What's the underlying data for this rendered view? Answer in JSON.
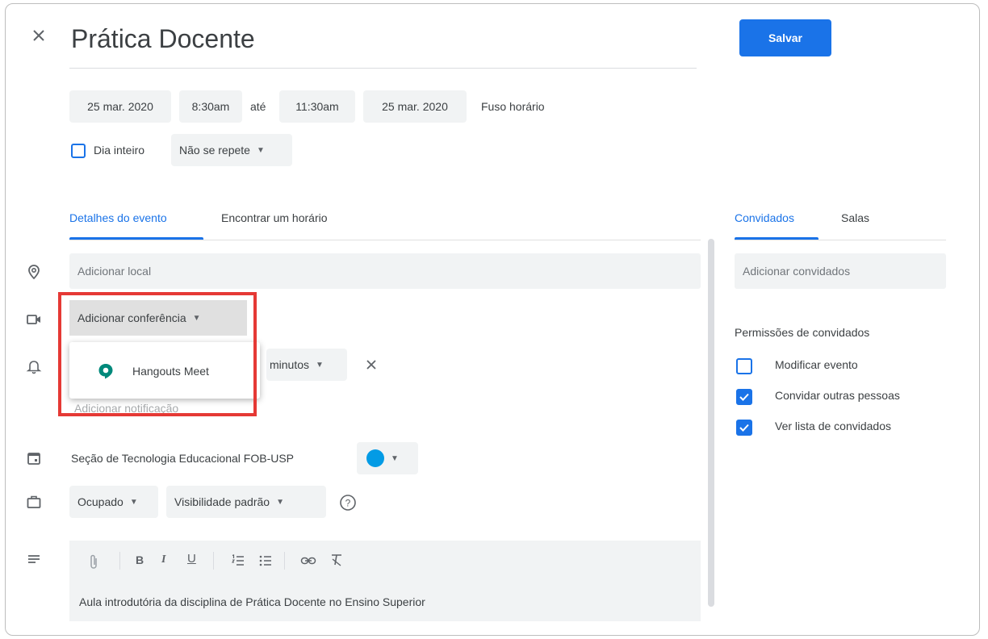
{
  "header": {
    "title": "Prática Docente",
    "save_label": "Salvar"
  },
  "datetime": {
    "start_date": "25 mar. 2020",
    "start_time": "8:30am",
    "until": "até",
    "end_time": "11:30am",
    "end_date": "25 mar. 2020",
    "timezone": "Fuso horário",
    "all_day_label": "Dia inteiro",
    "repeat": "Não se repete"
  },
  "tabs": [
    {
      "label": "Detalhes do evento"
    },
    {
      "label": "Encontrar um horário"
    }
  ],
  "details": {
    "location_placeholder": "Adicionar local",
    "conference_label": "Adicionar conferência",
    "hangouts_label": "Hangouts Meet",
    "notification_unit": "minutos",
    "add_notification": "Adicionar notificação",
    "calendar_name": "Seção de Tecnologia Educacional FOB-USP",
    "busy": "Ocupado",
    "visibility": "Visibilidade padrão",
    "description": "Aula introdutória da disciplina de Prática Docente no Ensino Superior"
  },
  "toolbar": {
    "bold": "B",
    "italic": "I",
    "underline": "U"
  },
  "guests": {
    "tabs": [
      {
        "label": "Convidados"
      },
      {
        "label": "Salas"
      }
    ],
    "add_placeholder": "Adicionar convidados",
    "permissions_title": "Permissões de convidados",
    "permissions": [
      {
        "label": "Modificar evento",
        "checked": false
      },
      {
        "label": "Convidar outras pessoas",
        "checked": true
      },
      {
        "label": "Ver lista de convidados",
        "checked": true
      }
    ]
  },
  "colors": {
    "accent": "#1a73e8",
    "highlight": "#e53935",
    "calendar_color": "#039be5"
  }
}
